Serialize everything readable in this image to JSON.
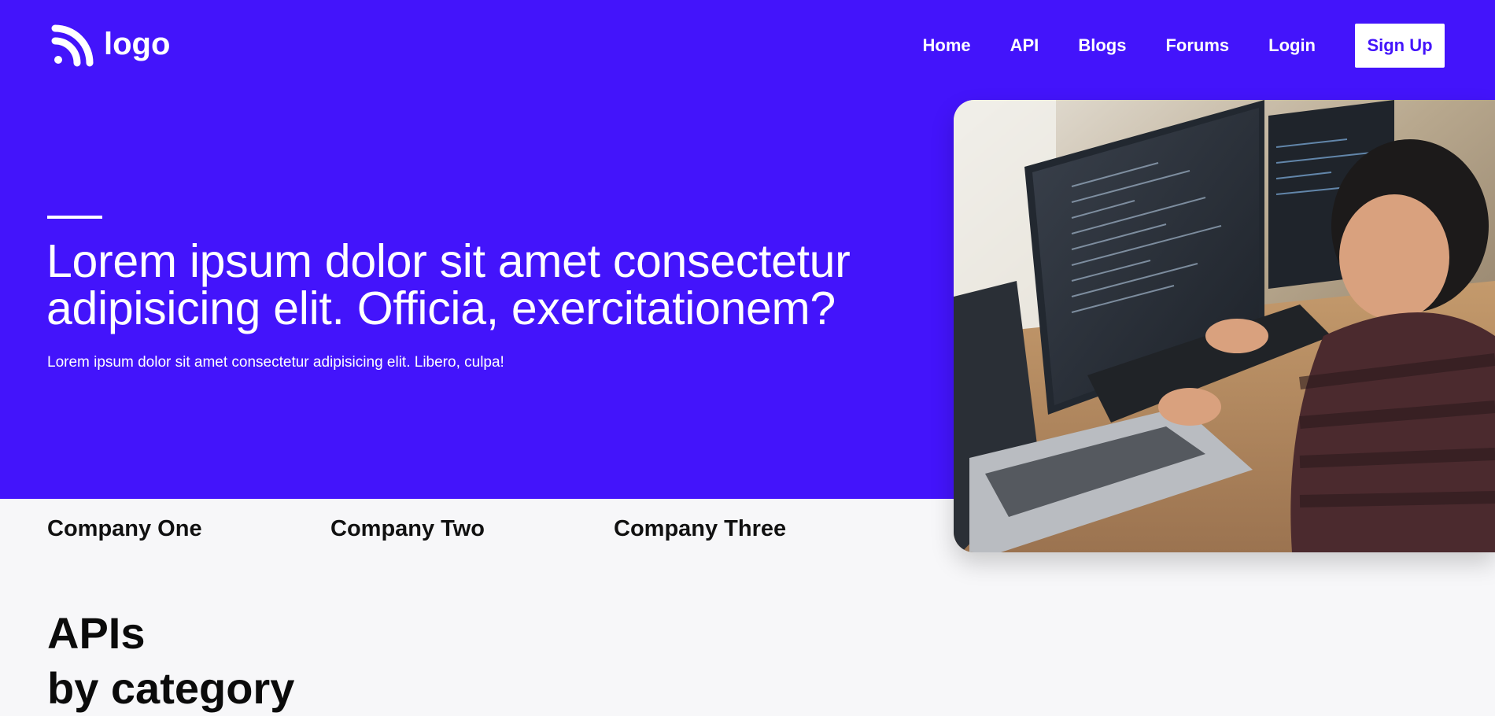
{
  "nav": {
    "logo_text": "logo",
    "links": [
      "Home",
      "API",
      "Blogs",
      "Forums",
      "Login"
    ],
    "signup_label": "Sign Up"
  },
  "hero": {
    "headline": "Lorem ipsum dolor sit amet consectetur adipisicing elit. Officia, exercitationem?",
    "subheadline": "Lorem ipsum dolor sit amet consectetur adipisicing elit. Libero, culpa!",
    "image": "developer-coding-photo"
  },
  "companies": [
    "Company One",
    "Company Two",
    "Company Three"
  ],
  "section": {
    "title_line1": "APIs",
    "title_line2": "by category"
  },
  "colors": {
    "brand": "#4314fb",
    "background": "#f7f7f9",
    "text_dark": "#111111",
    "text_light": "#ffffff"
  }
}
